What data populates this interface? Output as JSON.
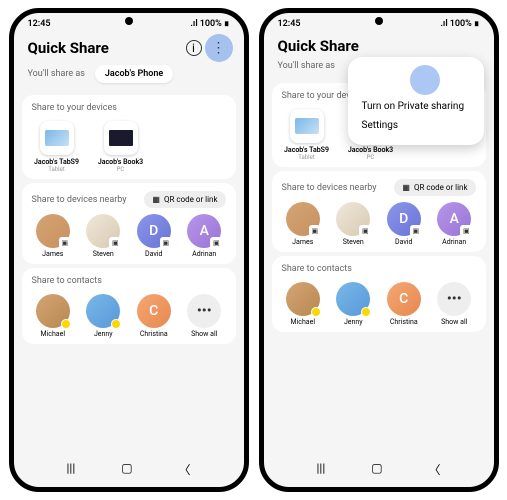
{
  "status": {
    "time": "12:45",
    "battery": "100%"
  },
  "title": "Quick Share",
  "shareas_label": "You'll share as",
  "shareas_value": "Jacob's Phone",
  "sections": {
    "devices": {
      "title": "Share to your devices",
      "items": [
        {
          "name": "Jacob's TabS9",
          "type": "Tablet"
        },
        {
          "name": "Jacob's Book3",
          "type": "PC"
        }
      ]
    },
    "nearby": {
      "title": "Share to devices nearby",
      "qr": "QR code or link",
      "items": [
        {
          "name": "James",
          "letter": ""
        },
        {
          "name": "Steven",
          "letter": ""
        },
        {
          "name": "David",
          "letter": "D"
        },
        {
          "name": "Adrinan",
          "letter": "A"
        }
      ]
    },
    "contacts": {
      "title": "Share to contacts",
      "items": [
        {
          "name": "Michael"
        },
        {
          "name": "Jenny"
        },
        {
          "name": "Christina",
          "letter": "C"
        },
        {
          "name": "Show all",
          "more": true
        }
      ]
    }
  },
  "popup": {
    "item1": "Turn on Private sharing",
    "item2": "Settings"
  }
}
